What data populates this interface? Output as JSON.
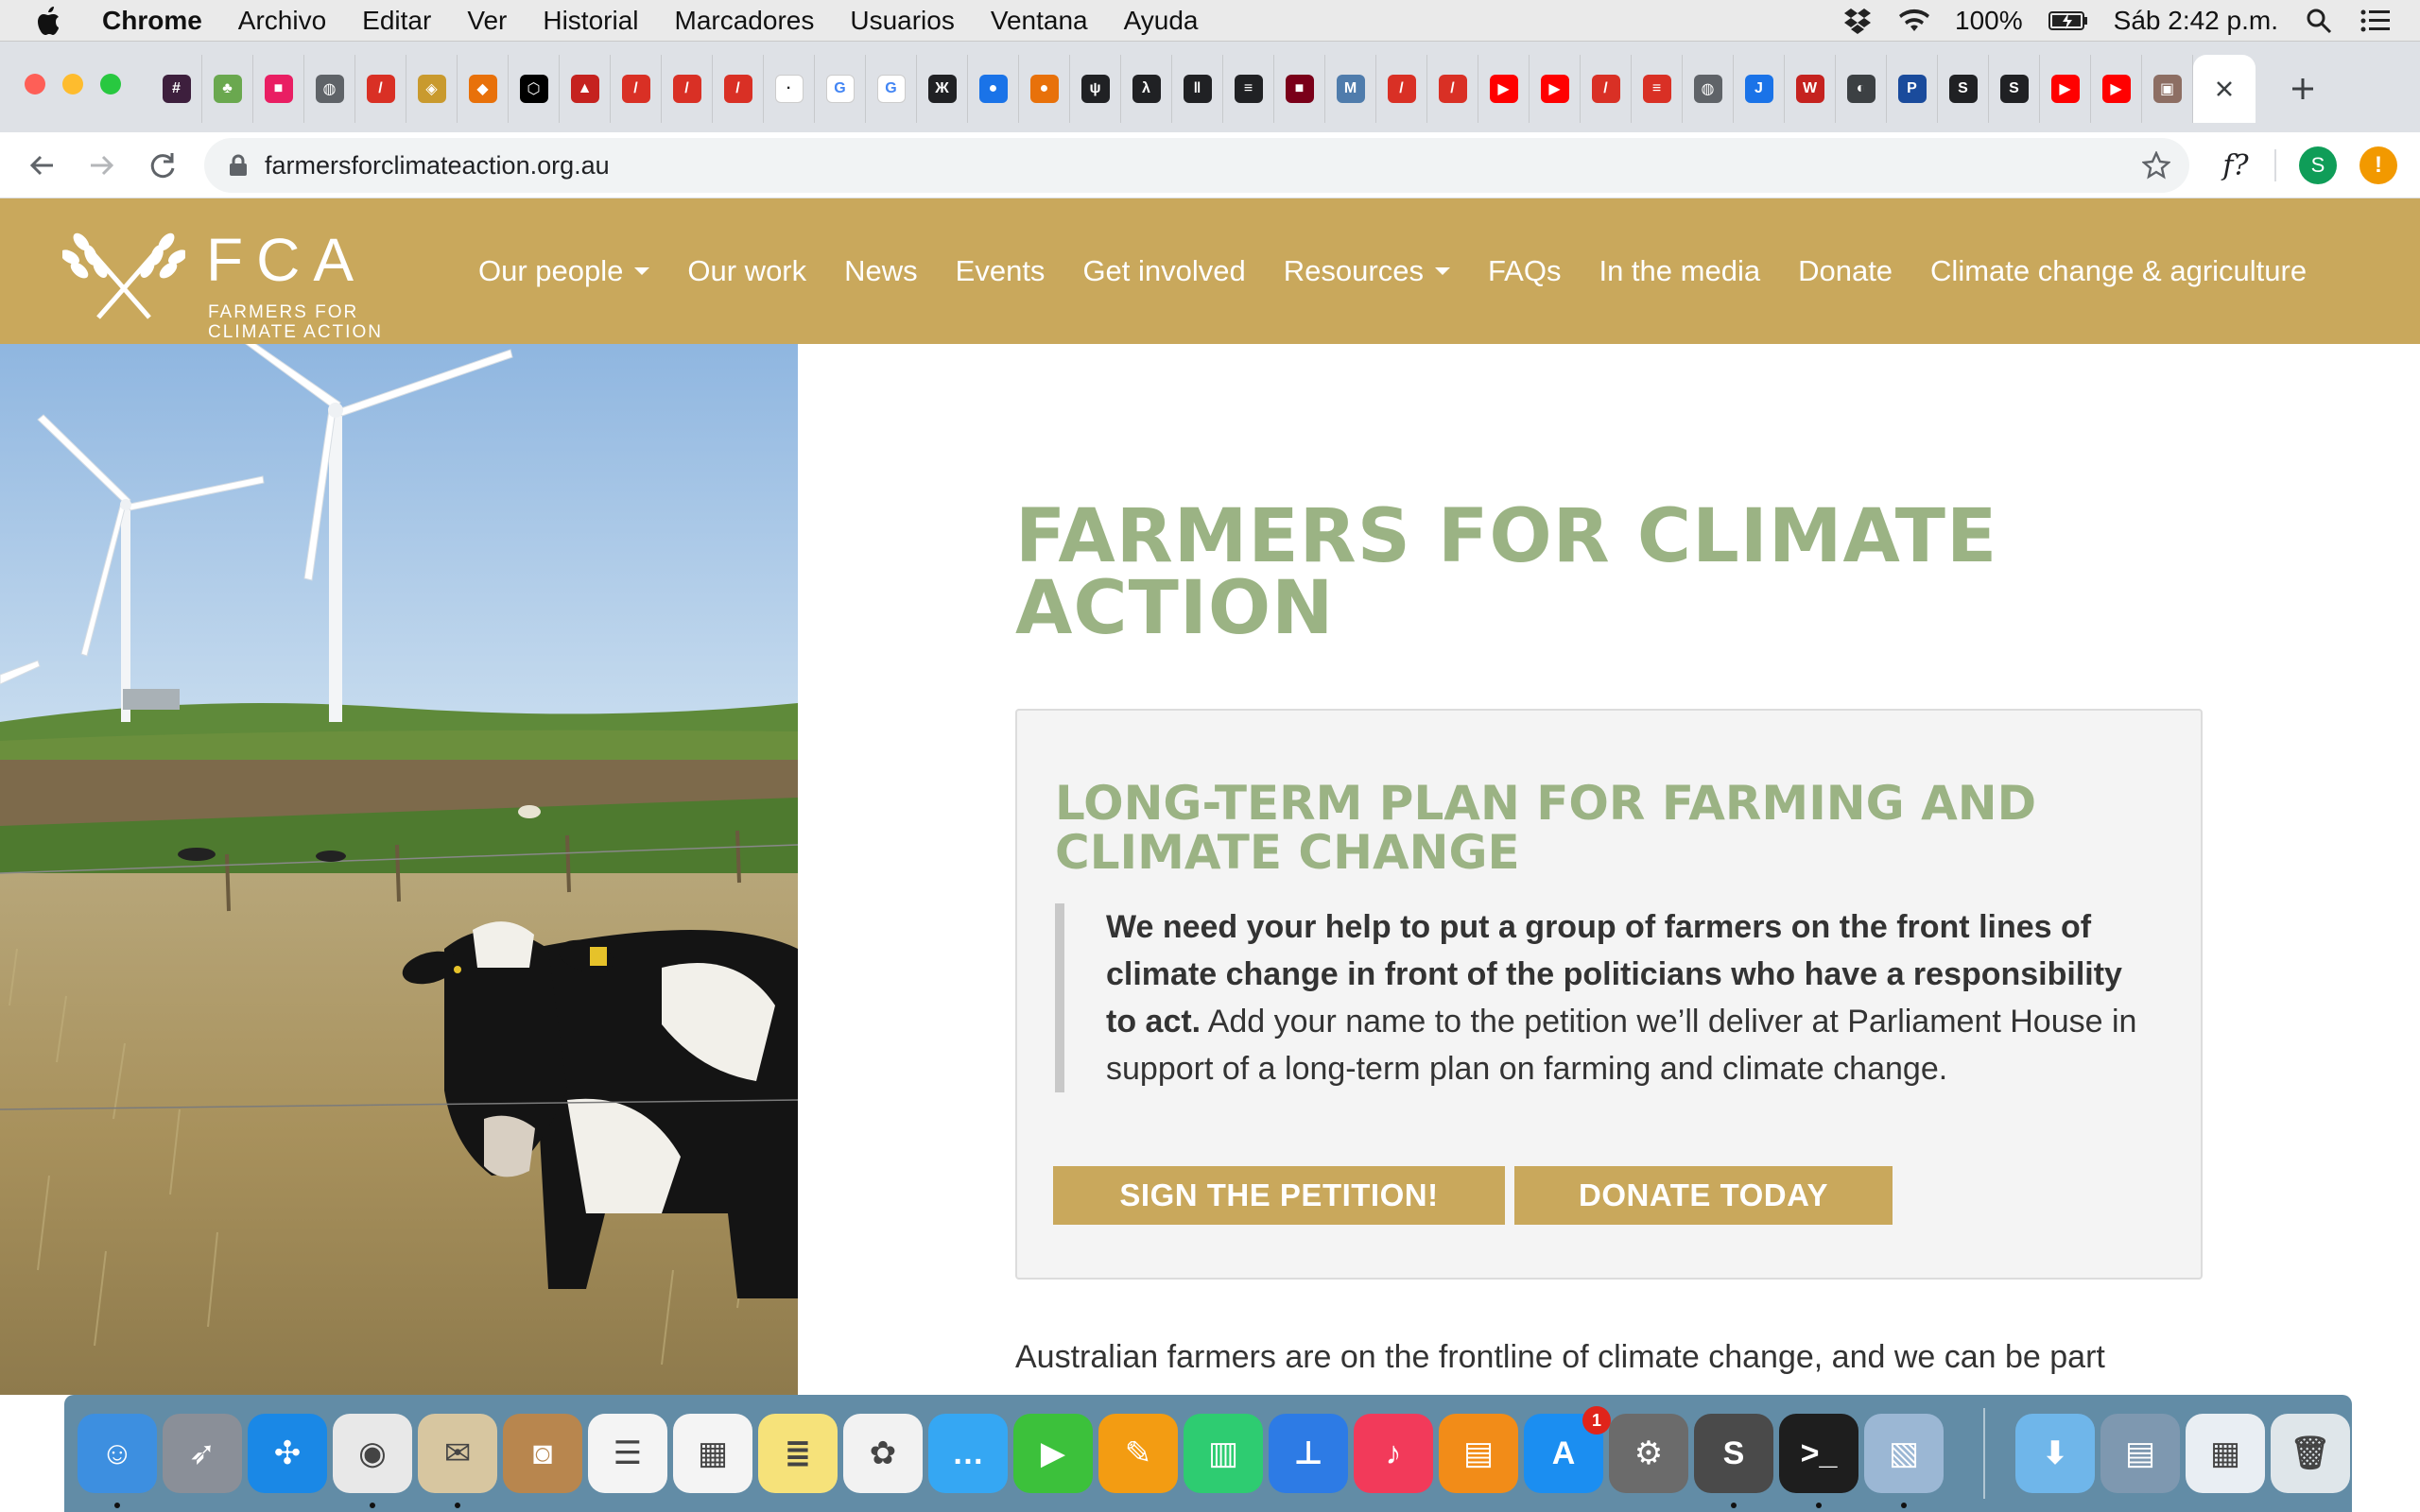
{
  "menubar": {
    "app": "Chrome",
    "items": [
      "Archivo",
      "Editar",
      "Ver",
      "Historial",
      "Marcadores",
      "Usuarios",
      "Ventana",
      "Ayuda"
    ],
    "battery": "100%",
    "clock": "Sáb 2:42 p.m."
  },
  "browser": {
    "url": "farmersforclimateaction.org.au",
    "ext_formula": "f?",
    "profile_initial": "S",
    "alert_glyph": "!"
  },
  "favicons": [
    {
      "name": "slack",
      "color": "#3d1f3d",
      "glyph": "#"
    },
    {
      "name": "green-people",
      "color": "#6aa84f",
      "glyph": "♣"
    },
    {
      "name": "shield-pink",
      "color": "#e91e63",
      "glyph": "■"
    },
    {
      "name": "globe",
      "color": "#5f6368",
      "glyph": "◍"
    },
    {
      "name": "slash-red",
      "color": "#d93025",
      "glyph": "/"
    },
    {
      "name": "badge",
      "color": "#c99a2e",
      "glyph": "◈"
    },
    {
      "name": "tiger",
      "color": "#e8710a",
      "glyph": "◆"
    },
    {
      "name": "codepen",
      "color": "#000000",
      "glyph": "⬡"
    },
    {
      "name": "triangle",
      "color": "#c5221f",
      "glyph": "▲"
    },
    {
      "name": "slash-red-2",
      "color": "#d93025",
      "glyph": "/"
    },
    {
      "name": "slash-red-3",
      "color": "#d93025",
      "glyph": "/"
    },
    {
      "name": "slash-red-4",
      "color": "#d93025",
      "glyph": "/"
    },
    {
      "name": "square",
      "color": "#ffffff",
      "glyph": "·"
    },
    {
      "name": "google",
      "color": "#4285f4",
      "glyph": "G"
    },
    {
      "name": "google-2",
      "color": "#4285f4",
      "glyph": "G"
    },
    {
      "name": "tree",
      "color": "#202124",
      "glyph": "Ж"
    },
    {
      "name": "drop",
      "color": "#1a73e8",
      "glyph": "●"
    },
    {
      "name": "circle-orange",
      "color": "#e8710a",
      "glyph": "●"
    },
    {
      "name": "hand",
      "color": "#202124",
      "glyph": "ψ"
    },
    {
      "name": "walker",
      "color": "#202124",
      "glyph": "λ"
    },
    {
      "name": "barcode",
      "color": "#202124",
      "glyph": "‖"
    },
    {
      "name": "lines",
      "color": "#202124",
      "glyph": "≡"
    },
    {
      "name": "dark-square",
      "color": "#7a0019",
      "glyph": "■"
    },
    {
      "name": "mdb",
      "color": "#4f7cac",
      "glyph": "M"
    },
    {
      "name": "slash-t",
      "color": "#d93025",
      "glyph": "/"
    },
    {
      "name": "slash-t-2",
      "color": "#d93025",
      "glyph": "/"
    },
    {
      "name": "youtube",
      "color": "#ff0000",
      "glyph": "▶"
    },
    {
      "name": "youtube-2",
      "color": "#ff0000",
      "glyph": "▶"
    },
    {
      "name": "slash-t-3",
      "color": "#d93025",
      "glyph": "/"
    },
    {
      "name": "flag-red",
      "color": "#d93025",
      "glyph": "≡"
    },
    {
      "name": "globe-2",
      "color": "#5f6368",
      "glyph": "◍"
    },
    {
      "name": "blue-j",
      "color": "#1a73e8",
      "glyph": "J"
    },
    {
      "name": "w-red",
      "color": "#c5221f",
      "glyph": "W"
    },
    {
      "name": "ghost",
      "color": "#3c4043",
      "glyph": "◐"
    },
    {
      "name": "ptc",
      "color": "#1a4b9c",
      "glyph": "P"
    },
    {
      "name": "s-hex",
      "color": "#202124",
      "glyph": "S"
    },
    {
      "name": "s-hex-2",
      "color": "#202124",
      "glyph": "S"
    },
    {
      "name": "youtube-3",
      "color": "#ff0000",
      "glyph": "▶"
    },
    {
      "name": "youtube-4",
      "color": "#ff0000",
      "glyph": "▶"
    },
    {
      "name": "photo",
      "color": "#8d6e63",
      "glyph": "▣"
    }
  ],
  "site": {
    "logo_word": "FCA",
    "logo_sub_1": "FARMERS FOR",
    "logo_sub_2": "CLIMATE ACTION",
    "nav": [
      {
        "label": "Our people",
        "dropdown": true
      },
      {
        "label": "Our work",
        "dropdown": false
      },
      {
        "label": "News",
        "dropdown": false
      },
      {
        "label": "Events",
        "dropdown": false
      },
      {
        "label": "Get involved",
        "dropdown": false
      },
      {
        "label": "Resources",
        "dropdown": true
      },
      {
        "label": "FAQs",
        "dropdown": false
      },
      {
        "label": "In the media",
        "dropdown": false
      },
      {
        "label": "Donate",
        "dropdown": false
      },
      {
        "label": "Climate change & agriculture",
        "dropdown": false
      }
    ],
    "brand_color": "#c9a85c",
    "title_color": "#9bb384"
  },
  "content": {
    "title_line1": "FARMERS FOR CLIMATE",
    "title_line2": "ACTION",
    "card_title_line1": "LONG-TERM PLAN FOR FARMING AND",
    "card_title_line2": "CLIMATE CHANGE",
    "quote_bold": "We need your help to put a group of farmers on the front lines of climate change in front of the politicians who have a responsibility to act.",
    "quote_rest": " Add your name to the petition we’ll deliver at Parliament House in support of a long-term plan on farming and climate change.",
    "btn_petition": "SIGN THE PETITION!",
    "btn_donate": "DONATE TODAY",
    "body_text": "Australian farmers are on the frontline of climate change, and we can be part"
  },
  "dock": {
    "apps": [
      {
        "name": "finder",
        "color": "#3d8fe0",
        "glyph": "☺",
        "running": true
      },
      {
        "name": "launchpad",
        "color": "#8a8f98",
        "glyph": "➶",
        "running": false
      },
      {
        "name": "safari",
        "color": "#1a88e6",
        "glyph": "✣",
        "running": false
      },
      {
        "name": "chrome",
        "color": "#e8e8e8",
        "glyph": "◉",
        "running": true
      },
      {
        "name": "mail-preview",
        "color": "#d7c6a0",
        "glyph": "✉",
        "running": true
      },
      {
        "name": "contacts",
        "color": "#b8864e",
        "glyph": "◙",
        "running": false
      },
      {
        "name": "reminders",
        "color": "#f4f4f4",
        "glyph": "☰",
        "running": false
      },
      {
        "name": "calendar",
        "color": "#f4f4f4",
        "glyph": "▦",
        "running": false
      },
      {
        "name": "notes",
        "color": "#f6e27a",
        "glyph": "≣",
        "running": false
      },
      {
        "name": "photos",
        "color": "#f2f2f2",
        "glyph": "✿",
        "running": false
      },
      {
        "name": "messages",
        "color": "#35a7f3",
        "glyph": "…",
        "running": false
      },
      {
        "name": "facetime",
        "color": "#3cc13b",
        "glyph": "▶",
        "running": false
      },
      {
        "name": "pages",
        "color": "#f39c12",
        "glyph": "✎",
        "running": false
      },
      {
        "name": "numbers",
        "color": "#2ecc71",
        "glyph": "▥",
        "running": false
      },
      {
        "name": "keynote",
        "color": "#2d7be5",
        "glyph": "⊥",
        "running": false
      },
      {
        "name": "music",
        "color": "#f23a5a",
        "glyph": "♪",
        "running": false
      },
      {
        "name": "books",
        "color": "#f28c18",
        "glyph": "▤",
        "running": false
      },
      {
        "name": "app-store",
        "color": "#1b8ef1",
        "glyph": "A",
        "running": false,
        "badge": "1"
      },
      {
        "name": "system-preferences",
        "color": "#6b6b6b",
        "glyph": "⚙",
        "running": false
      },
      {
        "name": "sublime-text",
        "color": "#4a4a4a",
        "glyph": "S",
        "running": true
      },
      {
        "name": "terminal",
        "color": "#1e1e1e",
        "glyph": ">_",
        "running": true
      },
      {
        "name": "preview",
        "color": "#9bb7d4",
        "glyph": "▧",
        "running": true
      },
      {
        "name": "downloads-folder",
        "color": "#6fb6ea",
        "glyph": "⬇",
        "running": false
      },
      {
        "name": "desktop-stack",
        "color": "#7e98b0",
        "glyph": "▤",
        "running": false
      },
      {
        "name": "screenshot-stack",
        "color": "#e9eef3",
        "glyph": "▦",
        "running": false
      },
      {
        "name": "trash",
        "color": "#dfe6ea",
        "glyph": "🗑",
        "running": false
      }
    ]
  }
}
